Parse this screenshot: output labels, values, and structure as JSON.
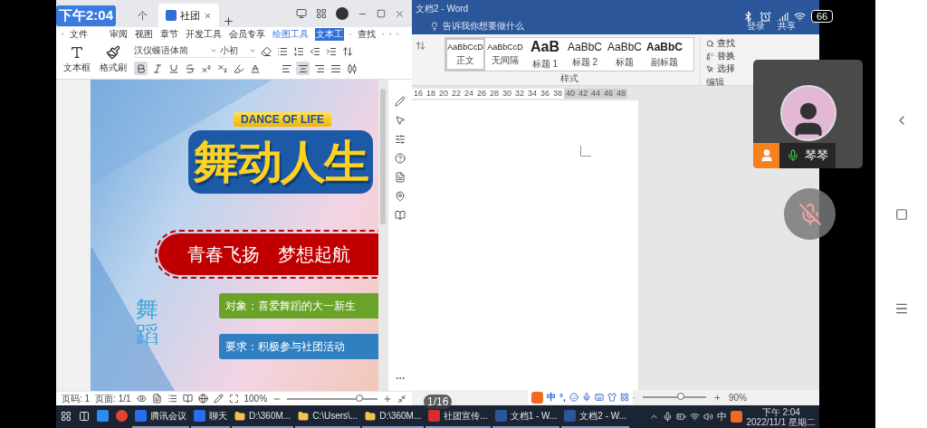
{
  "phone_status": {
    "time": "下午2:04",
    "battery": "66"
  },
  "wps": {
    "tabs": [
      {
        "label": "个",
        "selected": false
      },
      {
        "label": "社团",
        "selected": true
      }
    ],
    "menu": {
      "file": "文件",
      "items": [
        {
          "label": "审阅",
          "kind": "normal",
          "selected": false
        },
        {
          "label": "视图",
          "kind": "normal",
          "selected": false
        },
        {
          "label": "章节",
          "kind": "normal",
          "selected": false
        },
        {
          "label": "开发工具",
          "kind": "normal",
          "selected": false
        },
        {
          "label": "会员专享",
          "kind": "normal",
          "selected": false
        },
        {
          "label": "绘图工具",
          "kind": "context",
          "selected": false
        },
        {
          "label": "文本工",
          "kind": "context",
          "selected": true
        }
      ],
      "search": "查找"
    },
    "toolbar": {
      "textbox": "文本框",
      "painter": "格式刷",
      "font": "汉仪蝶语体简",
      "size": "小初",
      "format_buttons": [
        {
          "kind": "bold",
          "selected": true
        },
        {
          "kind": "italic",
          "selected": false
        },
        {
          "kind": "underline",
          "selected": false
        },
        {
          "kind": "strike",
          "selected": false
        },
        {
          "kind": "superscript",
          "selected": false
        },
        {
          "kind": "subscript",
          "selected": false
        },
        {
          "kind": "highlight",
          "selected": false
        },
        {
          "kind": "color",
          "selected": false
        }
      ],
      "align_buttons": [
        {
          "kind": "left",
          "selected": false
        },
        {
          "kind": "center",
          "selected": true
        },
        {
          "kind": "right",
          "selected": false
        },
        {
          "kind": "justify",
          "selected": false
        },
        {
          "kind": "distribute",
          "selected": false
        }
      ]
    },
    "poster": {
      "subtitle": "DANCE OF LIFE",
      "title": "舞动人生",
      "slogan": "青春飞扬　梦想起航",
      "side_text": "舞蹈",
      "items": [
        {
          "text": "对象：喜爱舞蹈的大一新生",
          "color": "#6aa329"
        },
        {
          "text": "要求：积极参与社团活动",
          "color": "#2f7fc1"
        }
      ]
    },
    "status": {
      "page": "页码: 1",
      "pages": "页面: 1/1",
      "zoom": "100%",
      "level": 0.8
    }
  },
  "word": {
    "title": "文档2 - Word",
    "tell_me": "告诉我你想要做什么",
    "account": "登录",
    "share": "共享",
    "styles": [
      {
        "preview": "AaBbCcD",
        "name": "正文",
        "kind": "body",
        "selected": true
      },
      {
        "preview": "AaBbCcD",
        "name": "无间隔",
        "kind": "body",
        "selected": false
      },
      {
        "preview": "AaB",
        "name": "标题 1",
        "kind": "heading1",
        "selected": false
      },
      {
        "preview": "AaBbC",
        "name": "标题 2",
        "kind": "heading2",
        "selected": false
      },
      {
        "preview": "AaBbC",
        "name": "标题",
        "kind": "heading2",
        "selected": false
      },
      {
        "preview": "AaBbC",
        "name": "副标题",
        "kind": "subtitle",
        "selected": false
      }
    ],
    "styles_label": "样式",
    "edit": [
      {
        "label": "查找",
        "kind": "find"
      },
      {
        "label": "替换",
        "kind": "replace"
      },
      {
        "label": "选择",
        "kind": "select"
      }
    ],
    "edit_label": "编辑",
    "ruler": [
      {
        "label": "16",
        "margin": false
      },
      {
        "label": "18",
        "margin": false
      },
      {
        "label": "20",
        "margin": false
      },
      {
        "label": "22",
        "margin": false
      },
      {
        "label": "24",
        "margin": false
      },
      {
        "label": "26",
        "margin": false
      },
      {
        "label": "28",
        "margin": false
      },
      {
        "label": "30",
        "margin": false
      },
      {
        "label": "32",
        "margin": false
      },
      {
        "label": "34",
        "margin": false
      },
      {
        "label": "36",
        "margin": false
      },
      {
        "label": "38",
        "margin": false
      },
      {
        "label": "40",
        "margin": true
      },
      {
        "label": "42",
        "margin": true
      },
      {
        "label": "44",
        "margin": true
      },
      {
        "label": "46",
        "margin": true
      },
      {
        "label": "48",
        "margin": true
      }
    ],
    "zoom": "90%",
    "level": 0.6
  },
  "ime": {
    "mode": "中",
    "punct": "°,"
  },
  "page_counter": "1/16",
  "meeting": {
    "name": "琴琴",
    "speaking": true,
    "muted": true
  },
  "taskbar": {
    "items": [
      {
        "kind": "start"
      },
      {
        "kind": "taskview"
      },
      {
        "kind": "chat-app"
      },
      {
        "kind": "browser"
      },
      {
        "kind": "meeting",
        "label": "腾讯会议"
      },
      {
        "kind": "meeting",
        "label": "聊天"
      },
      {
        "kind": "folder",
        "label": "D:\\360M..."
      },
      {
        "kind": "folder",
        "label": "C:\\Users\\..."
      },
      {
        "kind": "folder",
        "label": "D:\\360M..."
      },
      {
        "kind": "wps",
        "label": "社团宣传..."
      },
      {
        "kind": "word",
        "label": "文档1 - W..."
      },
      {
        "kind": "word",
        "label": "文档2 - W..."
      }
    ],
    "ime": "中",
    "time": "下午 2:04",
    "date": "2022/11/1 星期二"
  }
}
